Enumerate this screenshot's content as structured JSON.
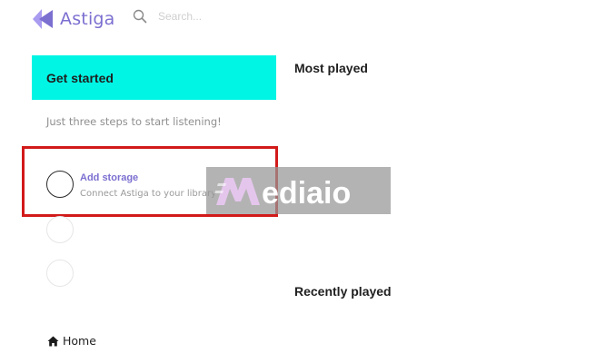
{
  "header": {
    "logo_text": "Astiga",
    "search": {
      "placeholder": "Search..."
    }
  },
  "get_started": {
    "title": "Get started",
    "subtitle": "Just three steps to start listening!",
    "steps": [
      {
        "title": "Add storage",
        "description": "Connect Astiga to your library"
      },
      {
        "title": "",
        "description": ""
      },
      {
        "title": "",
        "description": ""
      }
    ]
  },
  "sections": {
    "most_played": "Most played",
    "recently_played": "Recently played"
  },
  "nav": {
    "home_label": "Home"
  },
  "watermark": {
    "text": "Mediaio"
  },
  "colors": {
    "brand": "#7b6fd0",
    "banner": "#00f5e4",
    "highlight": "#d21a1a"
  },
  "icons": {
    "logo": "astiga-logo-icon",
    "search": "search-icon",
    "home": "home-icon"
  }
}
